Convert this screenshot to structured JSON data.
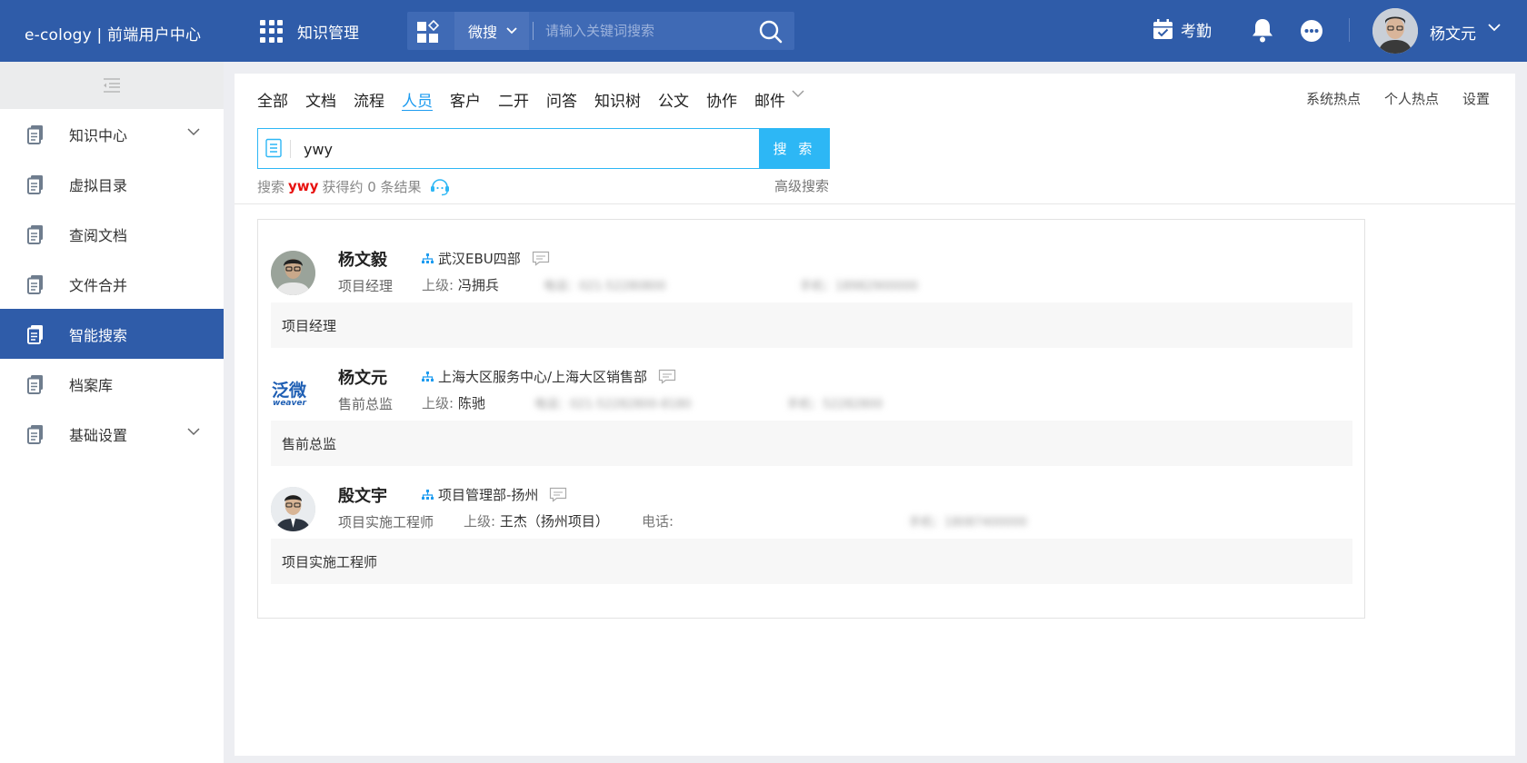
{
  "header": {
    "brand": "e-cology | 前端用户中心",
    "module": "知识管理",
    "search_scope": "微搜",
    "search_placeholder": "请输入关键词搜索",
    "attendance": "考勤",
    "username": "杨文元"
  },
  "sidebar": {
    "items": [
      {
        "label": "知识中心",
        "has_children": true
      },
      {
        "label": "虚拟目录"
      },
      {
        "label": "查阅文档"
      },
      {
        "label": "文件合并"
      },
      {
        "label": "智能搜索",
        "active": true
      },
      {
        "label": "档案库"
      },
      {
        "label": "基础设置",
        "has_children": true
      }
    ]
  },
  "tabs": [
    "全部",
    "文档",
    "流程",
    "人员",
    "客户",
    "二开",
    "问答",
    "知识树",
    "公文",
    "协作",
    "邮件"
  ],
  "active_tab": "人员",
  "right_links": [
    "系统热点",
    "个人热点",
    "设置"
  ],
  "search": {
    "value": "ywy",
    "button": "搜 索",
    "result_prefix": "搜索",
    "keyword": "ywy",
    "result_suffix": "获得约 0 条结果",
    "advanced": "高级搜索"
  },
  "people": [
    {
      "name": "杨文毅",
      "dept": "武汉EBU四部",
      "title": "项目经理",
      "superior_label": "上级:",
      "superior": "冯拥兵",
      "phone_blur": "电话：021-52280800",
      "mobile_blur": "手机：18982900000",
      "bar_text": "项目经理"
    },
    {
      "name": "杨文元",
      "dept": "上海大区服务中心/上海大区销售部",
      "title": "售前总监",
      "superior_label": "上级:",
      "superior": "陈驰",
      "phone_blur": "电话：021-52282800-8180",
      "mobile_blur": "手机：52282800",
      "bar_text": "售前总监",
      "avatar_text": "泛微",
      "avatar_subtext": "weaver"
    },
    {
      "name": "殷文宇",
      "dept": "项目管理部-扬州",
      "title": "项目实施工程师",
      "superior_label": "上级:",
      "superior": "王杰（扬州项目）",
      "phone_label": "电话:",
      "mobile_blur": "手机：18087400000",
      "bar_text": "项目实施工程师"
    }
  ],
  "colors": {
    "header_bg": "#2f5ca9",
    "accent": "#2db7f5",
    "active_tab": "#1e9cf0",
    "keyword": "#e8110f"
  }
}
